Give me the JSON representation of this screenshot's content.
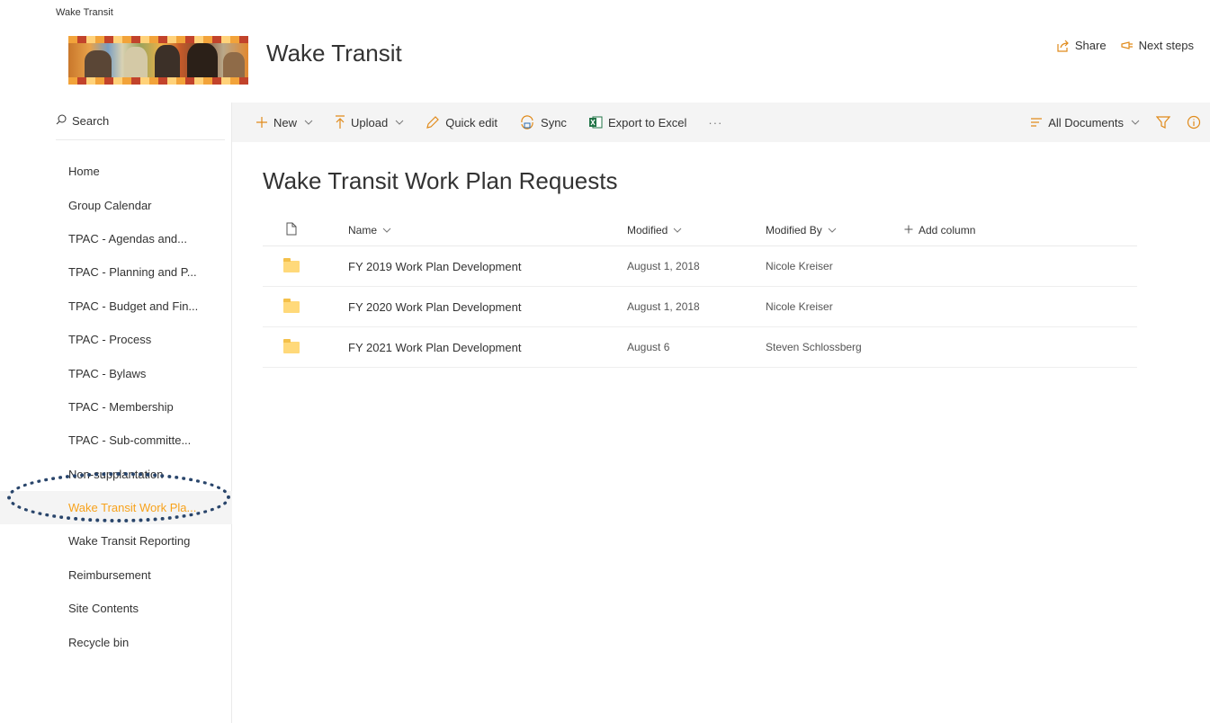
{
  "site": {
    "breadcrumb": "Wake Transit",
    "title": "Wake Transit"
  },
  "top_actions": {
    "share_label": "Share",
    "next_steps_label": "Next steps"
  },
  "search": {
    "placeholder": "Search"
  },
  "nav": {
    "items": [
      {
        "label": "Home"
      },
      {
        "label": "Group Calendar"
      },
      {
        "label": "TPAC - Agendas and..."
      },
      {
        "label": "TPAC - Planning and P..."
      },
      {
        "label": "TPAC - Budget and Fin..."
      },
      {
        "label": "TPAC - Process"
      },
      {
        "label": "TPAC - Bylaws"
      },
      {
        "label": "TPAC - Membership"
      },
      {
        "label": "TPAC - Sub-committe..."
      },
      {
        "label": "Non-supplantation"
      },
      {
        "label": "Wake Transit Work Pla...",
        "selected": true
      },
      {
        "label": "Wake Transit Reporting"
      },
      {
        "label": "Reimbursement"
      },
      {
        "label": "Site Contents"
      },
      {
        "label": "Recycle bin"
      }
    ]
  },
  "command_bar": {
    "new_label": "New",
    "upload_label": "Upload",
    "quick_edit_label": "Quick edit",
    "sync_label": "Sync",
    "export_label": "Export to Excel",
    "more_label": "···",
    "view_label": "All Documents"
  },
  "library": {
    "title": "Wake Transit Work Plan Requests",
    "columns": {
      "name": "Name",
      "modified": "Modified",
      "modified_by": "Modified By",
      "add_column": "Add column"
    },
    "rows": [
      {
        "name": "FY 2019 Work Plan Development",
        "modified": "August 1, 2018",
        "modified_by": "Nicole Kreiser"
      },
      {
        "name": "FY 2020 Work Plan Development",
        "modified": "August 1, 2018",
        "modified_by": "Nicole Kreiser"
      },
      {
        "name": "FY 2021 Work Plan Development",
        "modified": "August 6",
        "modified_by": "Steven Schlossberg"
      }
    ]
  },
  "icons": {
    "share": "share-icon",
    "next_steps": "next-steps-icon",
    "search": "search-icon",
    "new": "plus-icon",
    "upload": "upload-arrow-icon",
    "quick_edit": "pencil-icon",
    "sync": "sync-icon",
    "export": "excel-icon",
    "view": "view-lines-icon",
    "filter": "filter-icon",
    "info": "info-icon",
    "file_type": "document-icon",
    "folder": "folder-icon"
  },
  "colors": {
    "accent": "#f7a21b",
    "icon_accent": "#e08a1a",
    "command_bar_bg": "#f4f4f4",
    "highlight_ring": "#29456b"
  }
}
